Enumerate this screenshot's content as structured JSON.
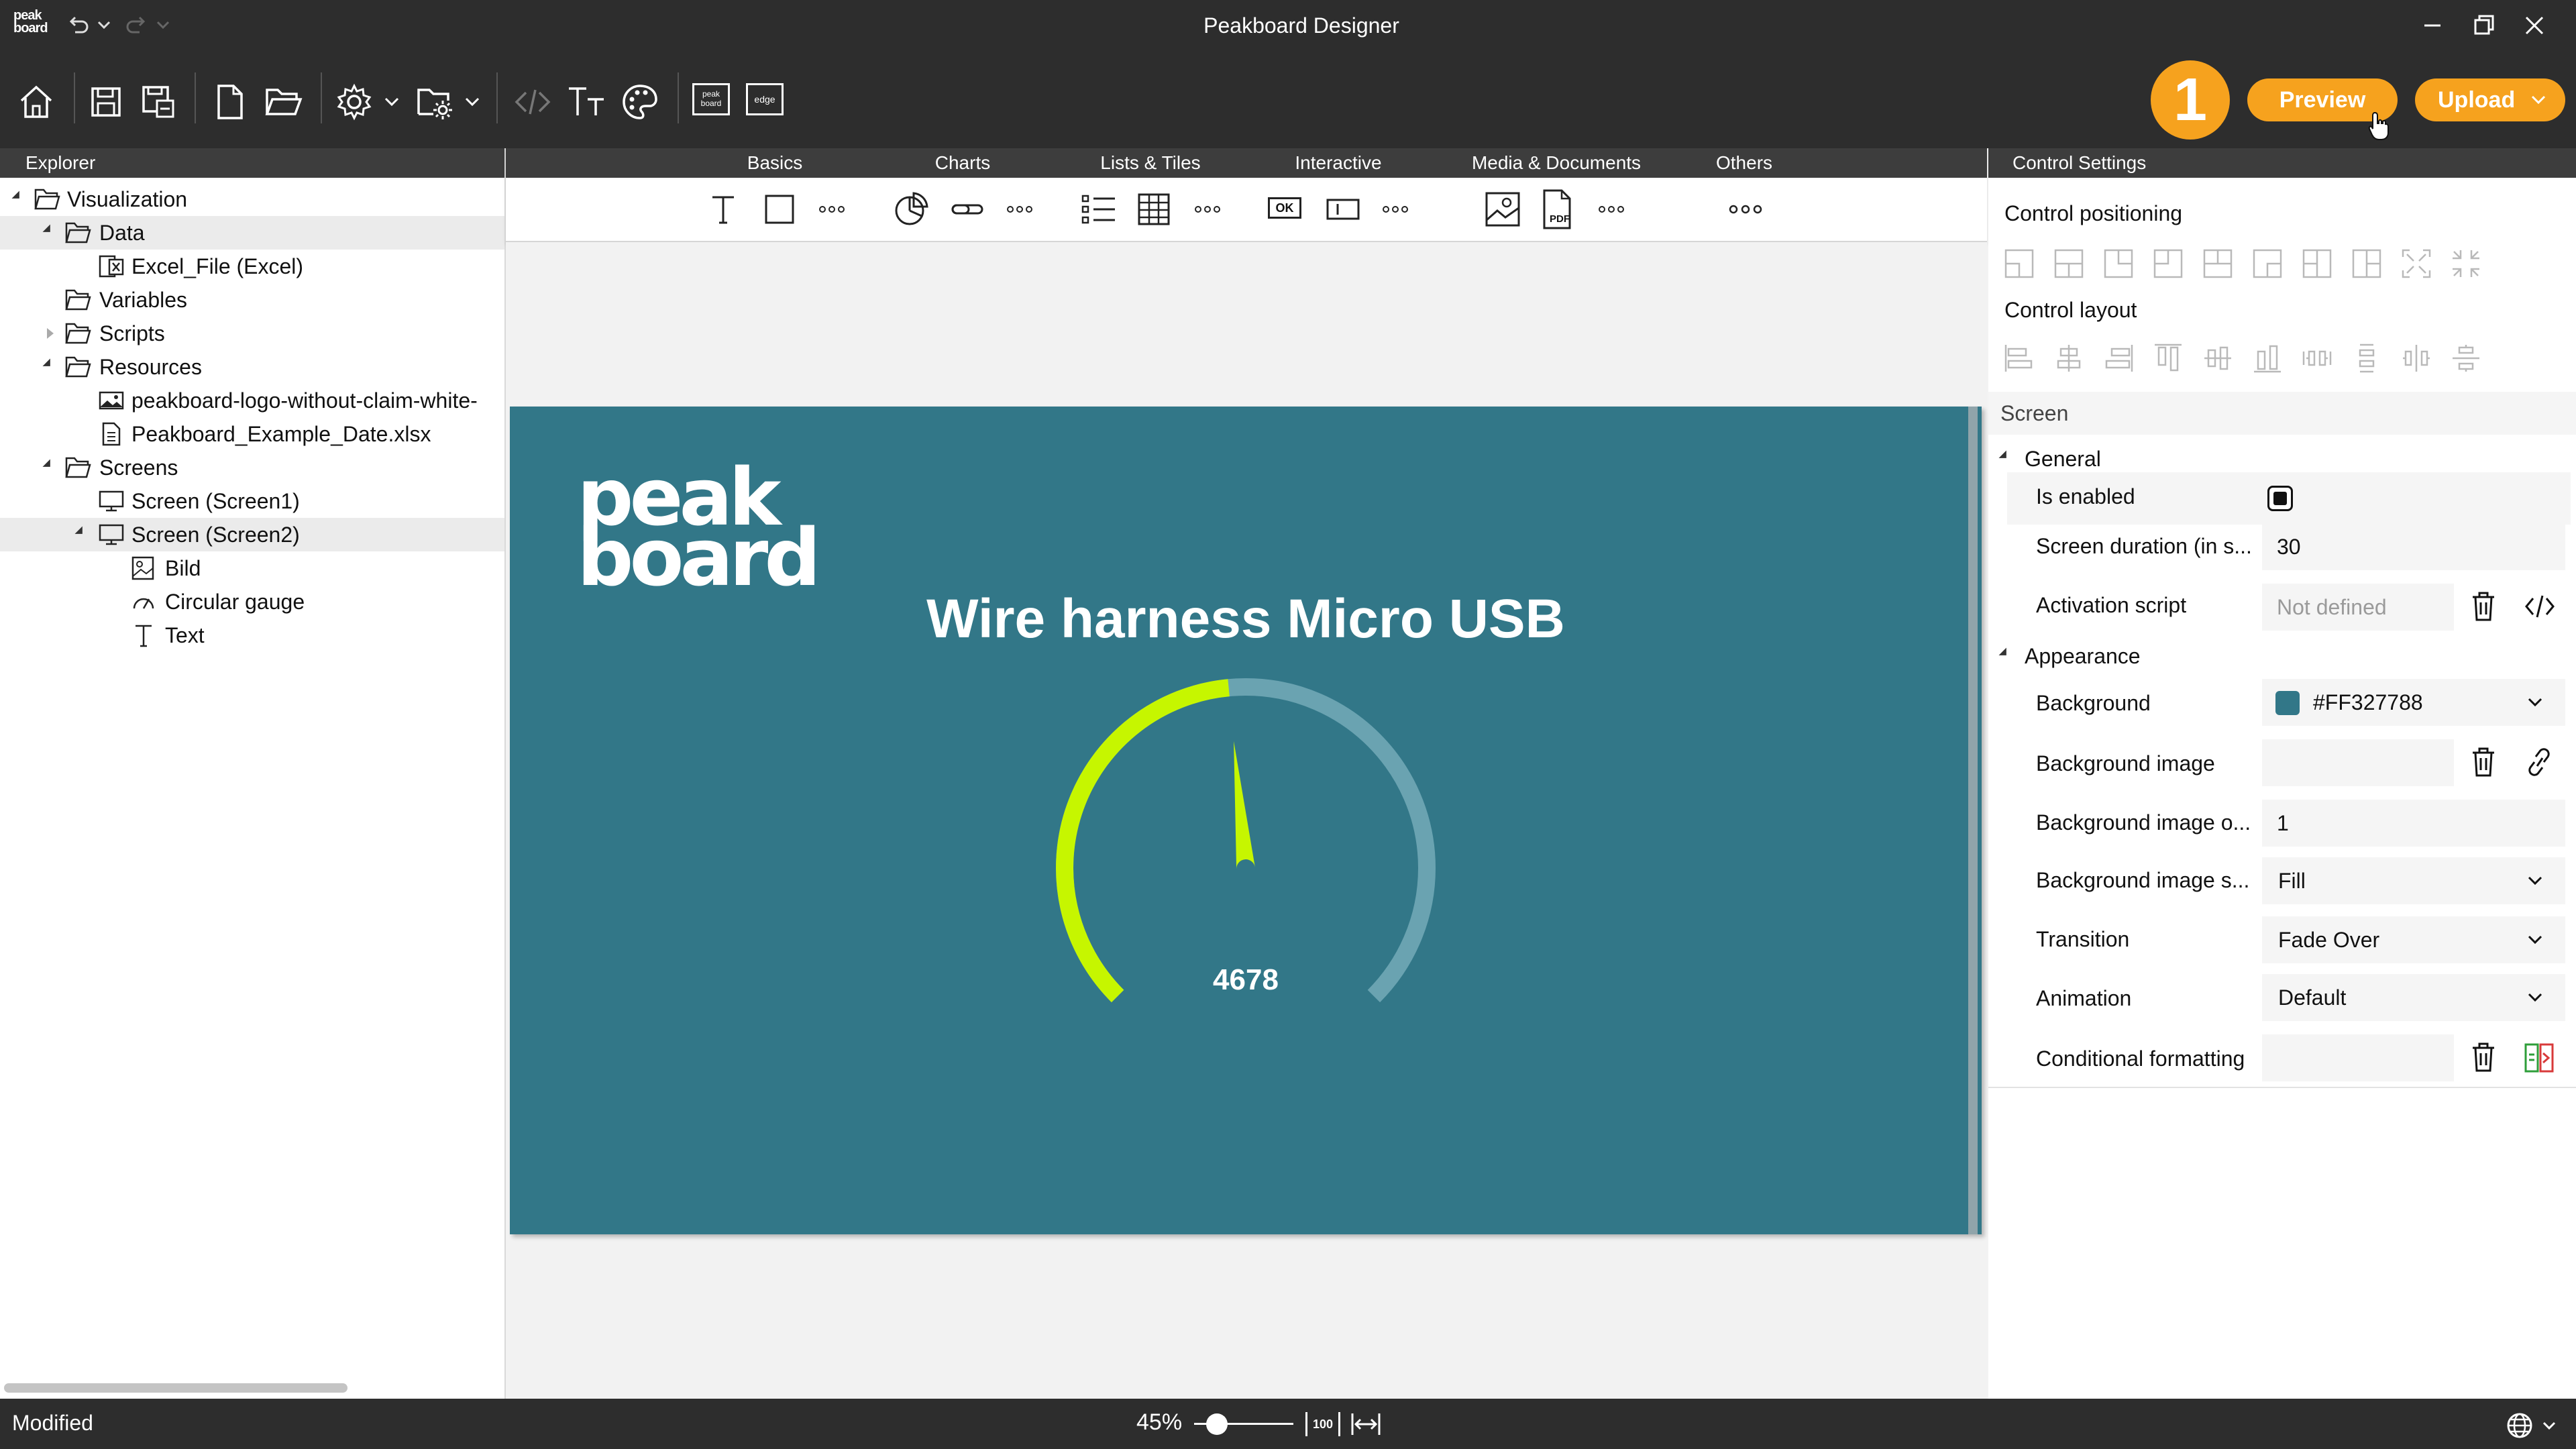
{
  "window": {
    "title": "Peakboard Designer",
    "logo_line1": "peak",
    "logo_line2": "board"
  },
  "toolbar": {
    "badge_number": "1",
    "preview_label": "Preview",
    "upload_label": "Upload",
    "mini_icon_1": "peak board",
    "mini_icon_2": "edge"
  },
  "explorer": {
    "title": "Explorer",
    "items": [
      {
        "label": "Visualization"
      },
      {
        "label": "Data"
      },
      {
        "label": "Excel_File (Excel)"
      },
      {
        "label": "Variables"
      },
      {
        "label": "Scripts"
      },
      {
        "label": "Resources"
      },
      {
        "label": "peakboard-logo-without-claim-white-"
      },
      {
        "label": "Peakboard_Example_Date.xlsx"
      },
      {
        "label": "Screens"
      },
      {
        "label": "Screen (Screen1)"
      },
      {
        "label": "Screen (Screen2)"
      },
      {
        "label": "Bild"
      },
      {
        "label": "Circular gauge"
      },
      {
        "label": "Text"
      }
    ]
  },
  "components": {
    "categories": [
      "Basics",
      "Charts",
      "Lists & Tiles",
      "Interactive",
      "Media & Documents",
      "Others"
    ],
    "ok_glyph": "OK",
    "pdf_glyph": "PDF"
  },
  "canvas": {
    "logo_line1": "peak",
    "logo_line2": "board",
    "title": "Wire harness Micro USB",
    "gauge_value": "4678",
    "gauge_fraction": 0.48,
    "background_color": "#327788",
    "gauge_color": "#c6f600",
    "gauge_track_color": "#6aa3b1"
  },
  "settings": {
    "title": "Control Settings",
    "control_positioning": "Control positioning",
    "control_layout": "Control layout",
    "screen_label": "Screen",
    "general_label": "General",
    "appearance_label": "Appearance",
    "props": {
      "is_enabled": "Is enabled",
      "screen_duration": "Screen duration (in s...",
      "screen_duration_value": "30",
      "activation_script": "Activation script",
      "activation_script_placeholder": "Not defined",
      "background": "Background",
      "background_value": "#FF327788",
      "background_swatch": "#327788",
      "background_image": "Background image",
      "background_image_opacity": "Background image o...",
      "background_image_opacity_value": "1",
      "background_image_stretch": "Background image s...",
      "background_image_stretch_value": "Fill",
      "transition": "Transition",
      "transition_value": "Fade Over",
      "animation": "Animation",
      "animation_value": "Default",
      "conditional_formatting": "Conditional formatting"
    }
  },
  "statusbar": {
    "status": "Modified",
    "zoom": "45%",
    "zoom_fraction": 0.12,
    "reset_glyph": "100"
  }
}
